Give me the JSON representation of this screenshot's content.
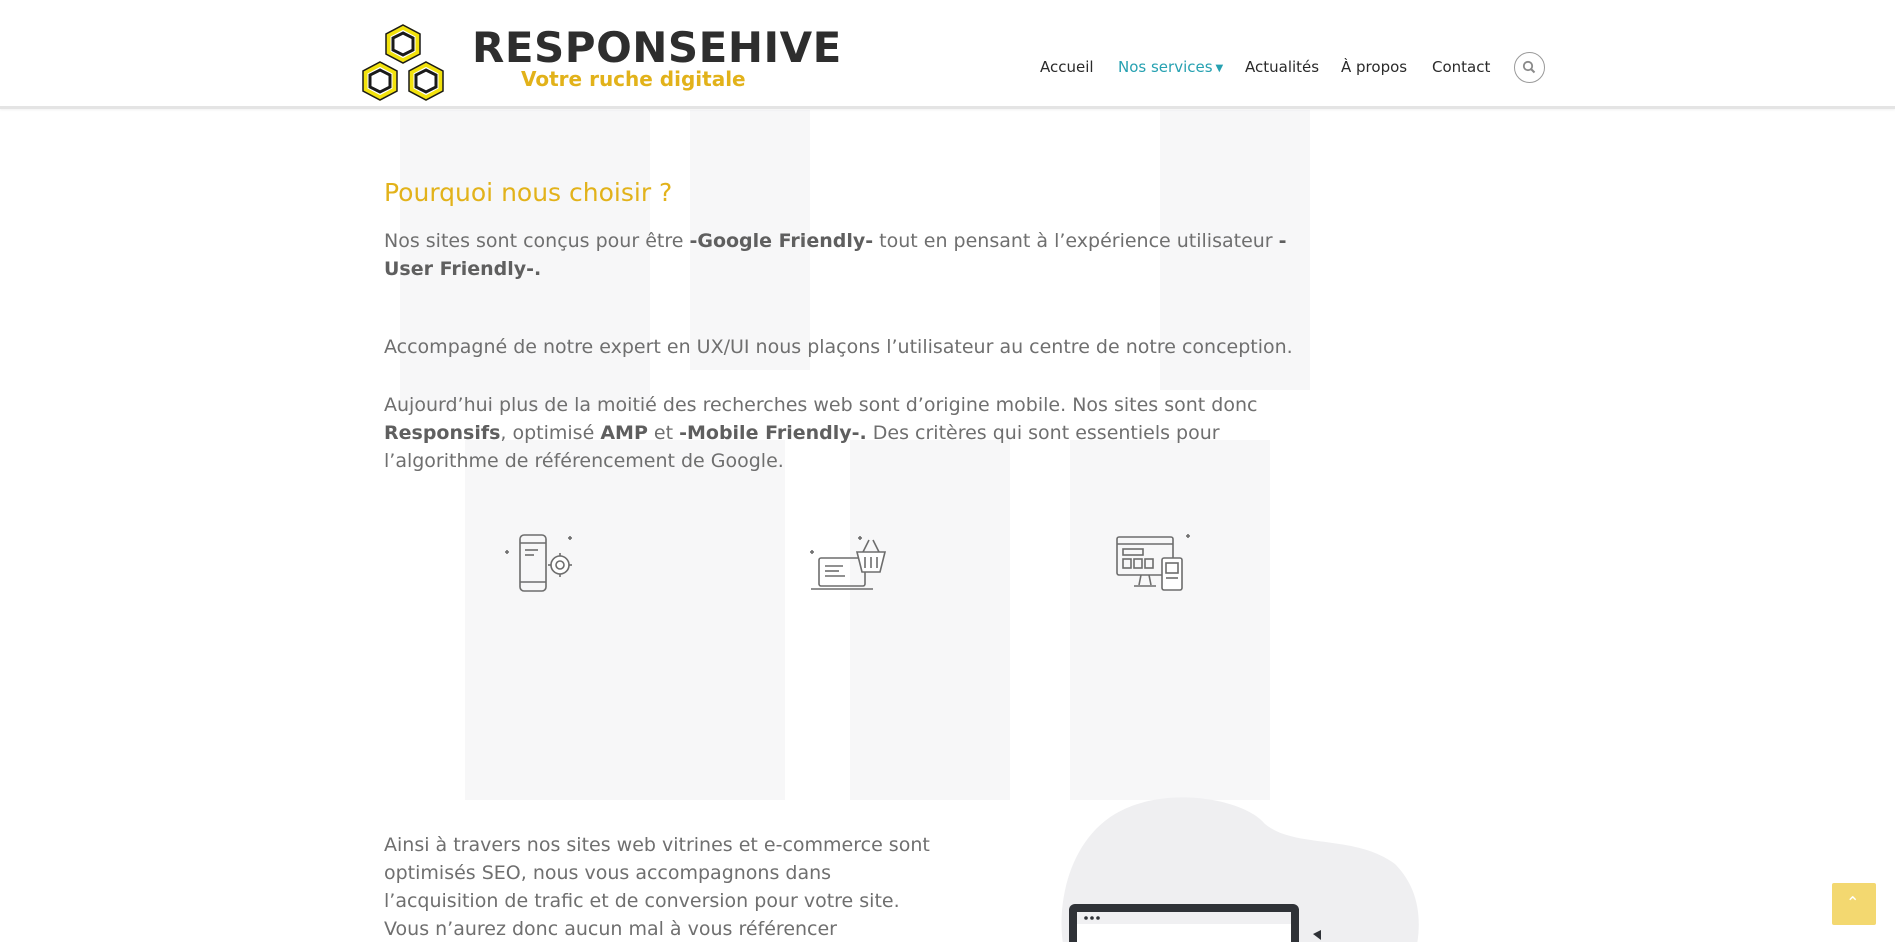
{
  "brand": {
    "name": "RESPONSEHIVE",
    "tagline": "Votre ruche digitale"
  },
  "nav": {
    "items": [
      {
        "label": "Accueil"
      },
      {
        "label": "Nos services"
      },
      {
        "label": "Actualités"
      },
      {
        "label": "À propos"
      },
      {
        "label": "Contact"
      }
    ],
    "active_index": 1,
    "search_icon": "search-icon",
    "dropdown_icon": "chevron-down-icon"
  },
  "section": {
    "heading": "Pourquoi nous choisir ?",
    "p1": {
      "t1": "Nos sites sont conçus pour être ",
      "b1": "-Google Friendly-",
      "t2": " tout en pensant à l’expérience utilisateur ",
      "b2": "-User Friendly-."
    },
    "p2": "Accompagné de notre expert en UX/UI nous plaçons l’utilisateur au centre de notre conception.",
    "p3": {
      "t1": "Aujourd’hui plus de la moitié des recherches web sont d’origine mobile. Nos sites sont donc ",
      "b1": "Responsifs",
      "t2": ", optimisé ",
      "b2": "AMP",
      "t3": " et ",
      "b3": "-Mobile Friendly-.",
      "t4": " Des critères qui sont essentiels pour l’algorithme de référencement de Google."
    },
    "features": [
      {
        "icon": "mobile-settings-icon"
      },
      {
        "icon": "laptop-shopping-basket-icon"
      },
      {
        "icon": "responsive-devices-icon"
      }
    ],
    "p4": "Ainsi à travers nos sites web vitrines et e-commerce sont optimisés SEO, nous vous accompagnons dans l’acquisition de trafic et de conversion pour votre site. Vous n’aurez donc aucun mal à vous référencer localement"
  },
  "colors": {
    "accent": "#e2b21a",
    "nav_active": "#26a1b1",
    "text": "#6f6f6f",
    "scroll_top_bg": "#f3d870"
  },
  "scroll_top_icon": "chevron-up-icon"
}
